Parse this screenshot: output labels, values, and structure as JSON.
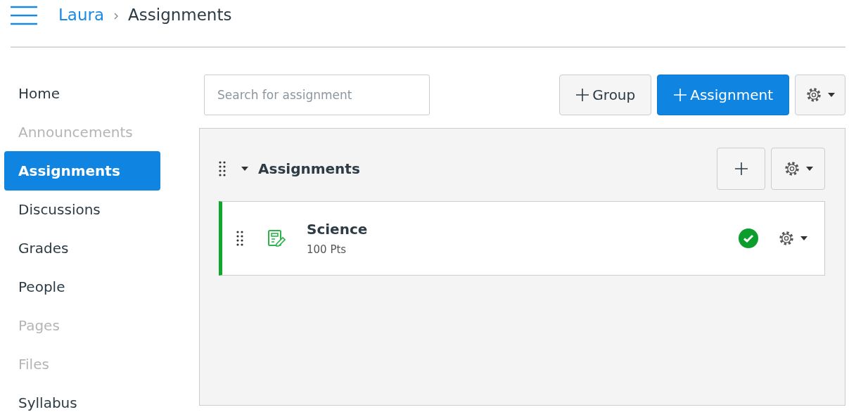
{
  "breadcrumb": [
    {
      "label": "Laura",
      "link": true
    },
    {
      "label": "Assignments",
      "link": false
    }
  ],
  "sidebar": {
    "items": [
      {
        "label": "Home",
        "selected": false,
        "disabled": false
      },
      {
        "label": "Announcements",
        "selected": false,
        "disabled": true
      },
      {
        "label": "Assignments",
        "selected": true,
        "disabled": false
      },
      {
        "label": "Discussions",
        "selected": false,
        "disabled": false
      },
      {
        "label": "Grades",
        "selected": false,
        "disabled": false
      },
      {
        "label": "People",
        "selected": false,
        "disabled": false
      },
      {
        "label": "Pages",
        "selected": false,
        "disabled": true
      },
      {
        "label": "Files",
        "selected": false,
        "disabled": true
      },
      {
        "label": "Syllabus",
        "selected": false,
        "disabled": false
      }
    ]
  },
  "search": {
    "placeholder": "Search for assignment"
  },
  "toolbar": {
    "group_button": "Group",
    "assignment_button": "Assignment"
  },
  "groups": [
    {
      "title": "Assignments",
      "expanded": true,
      "assignments": [
        {
          "title": "Science",
          "points": "100 Pts",
          "published": true
        }
      ]
    }
  ]
}
